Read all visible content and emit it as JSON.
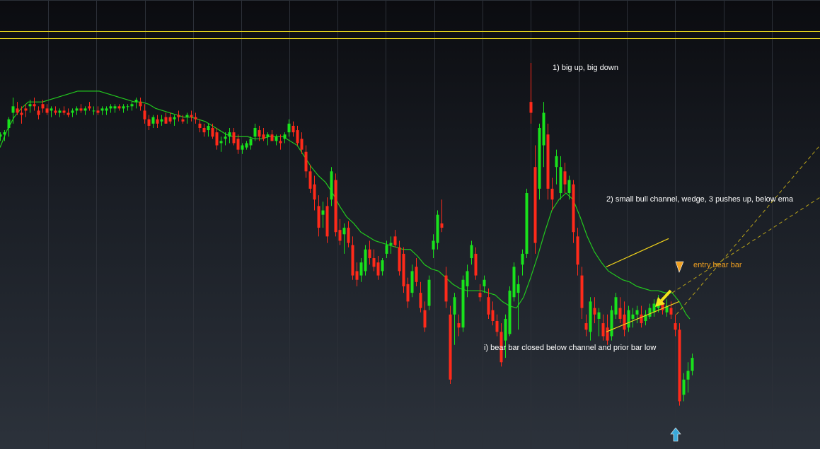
{
  "chart_data": {
    "type": "candlestick",
    "title": "",
    "xlabel": "",
    "ylabel": "",
    "grid": true,
    "colors": {
      "bull": "#19e21c",
      "bear": "#ff2a1a",
      "ema": "#22c81e",
      "price_line": "#e6d41c",
      "channel_line": "#f0d21a",
      "dashed_line": "#b8a21a",
      "arrow": "#f4e21c",
      "signal_arrow": "#f0a020",
      "up_arrow": "#3aa8d8",
      "text": "#ffffff",
      "orange_text": "#f0a020",
      "grid": "#2c3038"
    },
    "price_level": 5.0,
    "ema": [
      [
        0,
        79
      ],
      [
        10,
        87
      ],
      [
        20,
        93
      ],
      [
        30,
        97
      ],
      [
        40,
        100
      ],
      [
        50,
        100
      ],
      [
        60,
        100
      ],
      [
        70,
        101
      ],
      [
        80,
        102
      ],
      [
        90,
        103
      ],
      [
        100,
        104
      ],
      [
        110,
        105
      ],
      [
        120,
        105
      ],
      [
        130,
        105
      ],
      [
        140,
        105
      ],
      [
        150,
        104
      ],
      [
        160,
        103
      ],
      [
        170,
        102
      ],
      [
        180,
        101
      ],
      [
        190,
        100
      ],
      [
        200,
        100
      ],
      [
        210,
        99
      ],
      [
        220,
        97
      ],
      [
        230,
        96
      ],
      [
        240,
        95
      ],
      [
        250,
        94
      ],
      [
        260,
        93
      ],
      [
        270,
        93
      ],
      [
        280,
        92
      ],
      [
        290,
        91
      ],
      [
        300,
        89
      ],
      [
        310,
        87
      ],
      [
        320,
        85
      ],
      [
        330,
        84
      ],
      [
        340,
        84
      ],
      [
        350,
        84
      ],
      [
        360,
        83
      ],
      [
        370,
        83
      ],
      [
        380,
        84
      ],
      [
        390,
        84
      ],
      [
        400,
        84
      ],
      [
        410,
        82
      ],
      [
        420,
        80
      ],
      [
        430,
        75
      ],
      [
        440,
        70
      ],
      [
        450,
        66
      ],
      [
        460,
        63
      ],
      [
        470,
        58
      ],
      [
        480,
        52
      ],
      [
        490,
        47
      ],
      [
        500,
        44
      ],
      [
        510,
        40
      ],
      [
        520,
        38
      ],
      [
        530,
        36
      ],
      [
        540,
        35
      ],
      [
        550,
        34
      ],
      [
        560,
        33
      ],
      [
        570,
        32
      ],
      [
        580,
        32
      ],
      [
        590,
        29
      ],
      [
        600,
        25
      ],
      [
        610,
        23
      ],
      [
        620,
        22
      ],
      [
        630,
        19
      ],
      [
        640,
        16
      ],
      [
        650,
        14
      ],
      [
        660,
        13
      ],
      [
        670,
        13
      ],
      [
        680,
        13
      ],
      [
        690,
        12
      ],
      [
        700,
        11
      ],
      [
        710,
        8
      ],
      [
        720,
        6
      ],
      [
        730,
        5
      ],
      [
        740,
        10
      ],
      [
        750,
        19
      ],
      [
        760,
        29
      ],
      [
        770,
        40
      ],
      [
        780,
        50
      ],
      [
        790,
        55
      ],
      [
        800,
        58
      ],
      [
        810,
        55
      ],
      [
        820,
        47
      ],
      [
        830,
        38
      ],
      [
        840,
        31
      ],
      [
        850,
        26
      ],
      [
        860,
        22
      ],
      [
        870,
        20
      ],
      [
        880,
        18
      ],
      [
        890,
        17
      ],
      [
        900,
        15
      ],
      [
        910,
        14
      ],
      [
        920,
        13
      ],
      [
        930,
        13
      ],
      [
        940,
        12
      ],
      [
        950,
        12
      ],
      [
        960,
        8
      ],
      [
        970,
        2
      ],
      [
        975,
        0
      ]
    ],
    "candles": [
      [
        0,
        84,
        86,
        82,
        85
      ],
      [
        6,
        85,
        87,
        82,
        86
      ],
      [
        12,
        88,
        93,
        84,
        92
      ],
      [
        18,
        95,
        102,
        90,
        98
      ],
      [
        24,
        97,
        100,
        94,
        95
      ],
      [
        30,
        95,
        98,
        90,
        94
      ],
      [
        36,
        97,
        99,
        93,
        96
      ],
      [
        42,
        98,
        101,
        95,
        99
      ],
      [
        48,
        99,
        102,
        96,
        98
      ],
      [
        54,
        96,
        98,
        92,
        94
      ],
      [
        60,
        99,
        101,
        95,
        97
      ],
      [
        66,
        97,
        99,
        94,
        95
      ],
      [
        72,
        96,
        98,
        93,
        97
      ],
      [
        78,
        96,
        98,
        94,
        95
      ],
      [
        84,
        95,
        97,
        93,
        96
      ],
      [
        90,
        96,
        98,
        94,
        95
      ],
      [
        96,
        95,
        97,
        93,
        94
      ],
      [
        102,
        95,
        97,
        93,
        96
      ],
      [
        108,
        96,
        98,
        94,
        97
      ],
      [
        114,
        97,
        99,
        95,
        96
      ],
      [
        120,
        96,
        98,
        94,
        97
      ],
      [
        126,
        98,
        100,
        96,
        97
      ],
      [
        132,
        96,
        98,
        94,
        96
      ],
      [
        138,
        96,
        98,
        94,
        95
      ],
      [
        144,
        96,
        98,
        94,
        97
      ],
      [
        150,
        96,
        98,
        94,
        97
      ],
      [
        156,
        97,
        99,
        95,
        98
      ],
      [
        162,
        97,
        99,
        95,
        98
      ],
      [
        168,
        98,
        99,
        96,
        97
      ],
      [
        174,
        97,
        99,
        95,
        98
      ],
      [
        180,
        98,
        99,
        96,
        98
      ],
      [
        186,
        98,
        100,
        96,
        99
      ],
      [
        192,
        100,
        102,
        97,
        101
      ],
      [
        198,
        100,
        102,
        96,
        98
      ],
      [
        204,
        96,
        99,
        90,
        92
      ],
      [
        210,
        92,
        94,
        87,
        89
      ],
      [
        216,
        90,
        94,
        88,
        93
      ],
      [
        222,
        92,
        94,
        88,
        90
      ],
      [
        228,
        91,
        94,
        89,
        92
      ],
      [
        234,
        93,
        95,
        90,
        90
      ],
      [
        240,
        93,
        95,
        90,
        91
      ],
      [
        246,
        92,
        94,
        89,
        93
      ],
      [
        252,
        94,
        96,
        91,
        93
      ],
      [
        258,
        92,
        94,
        90,
        91
      ],
      [
        264,
        93,
        95,
        90,
        94
      ],
      [
        270,
        94,
        96,
        91,
        93
      ],
      [
        276,
        93,
        95,
        90,
        92
      ],
      [
        282,
        90,
        92,
        86,
        88
      ],
      [
        288,
        88,
        90,
        84,
        86
      ],
      [
        294,
        87,
        90,
        84,
        89
      ],
      [
        300,
        88,
        90,
        83,
        84
      ],
      [
        306,
        86,
        88,
        78,
        80
      ],
      [
        312,
        81,
        84,
        77,
        82
      ],
      [
        318,
        83,
        86,
        80,
        84
      ],
      [
        324,
        84,
        88,
        81,
        86
      ],
      [
        330,
        86,
        88,
        80,
        81
      ],
      [
        336,
        83,
        85,
        76,
        78
      ],
      [
        342,
        78,
        81,
        76,
        80
      ],
      [
        348,
        79,
        82,
        78,
        81
      ],
      [
        354,
        80,
        84,
        78,
        83
      ],
      [
        360,
        84,
        90,
        82,
        88
      ],
      [
        366,
        87,
        89,
        82,
        84
      ],
      [
        372,
        85,
        88,
        82,
        83
      ],
      [
        378,
        84,
        86,
        80,
        85
      ],
      [
        384,
        85,
        87,
        82,
        82
      ],
      [
        390,
        82,
        85,
        80,
        84
      ],
      [
        396,
        82,
        85,
        78,
        81
      ],
      [
        402,
        83,
        86,
        81,
        85
      ],
      [
        408,
        86,
        92,
        84,
        90
      ],
      [
        414,
        89,
        91,
        84,
        86
      ],
      [
        420,
        87,
        89,
        80,
        81
      ],
      [
        426,
        83,
        86,
        76,
        78
      ],
      [
        432,
        77,
        80,
        65,
        68
      ],
      [
        438,
        68,
        71,
        58,
        60
      ],
      [
        444,
        62,
        66,
        50,
        55
      ],
      [
        450,
        52,
        57,
        38,
        42
      ],
      [
        456,
        48,
        54,
        42,
        50
      ],
      [
        462,
        52,
        56,
        35,
        38
      ],
      [
        468,
        55,
        70,
        52,
        68
      ],
      [
        474,
        64,
        67,
        38,
        40
      ],
      [
        480,
        41,
        46,
        34,
        36
      ],
      [
        486,
        39,
        44,
        30,
        42
      ],
      [
        492,
        42,
        45,
        33,
        35
      ],
      [
        498,
        34,
        38,
        18,
        20
      ],
      [
        504,
        22,
        26,
        15,
        18
      ],
      [
        510,
        20,
        28,
        17,
        26
      ],
      [
        516,
        22,
        34,
        20,
        32
      ],
      [
        522,
        32,
        36,
        25,
        28
      ],
      [
        528,
        28,
        32,
        22,
        24
      ],
      [
        534,
        26,
        29,
        18,
        20
      ],
      [
        540,
        22,
        28,
        20,
        27
      ],
      [
        546,
        30,
        36,
        28,
        34
      ],
      [
        552,
        34,
        38,
        30,
        35
      ],
      [
        558,
        38,
        41,
        33,
        34
      ],
      [
        564,
        33,
        36,
        20,
        22
      ],
      [
        570,
        30,
        33,
        12,
        15
      ],
      [
        576,
        16,
        19,
        5,
        8
      ],
      [
        582,
        12,
        25,
        10,
        22
      ],
      [
        588,
        24,
        28,
        15,
        17
      ],
      [
        594,
        12,
        17,
        3,
        5
      ],
      [
        600,
        4,
        8,
        -6,
        -4
      ],
      [
        606,
        6,
        20,
        4,
        18
      ],
      [
        612,
        32,
        39,
        28,
        36
      ],
      [
        618,
        35,
        50,
        32,
        48
      ],
      [
        624,
        44,
        55,
        40,
        42
      ],
      [
        630,
        20,
        24,
        5,
        8
      ],
      [
        636,
        2,
        6,
        -30,
        -28
      ],
      [
        642,
        2,
        12,
        -12,
        10
      ],
      [
        648,
        -2,
        2,
        -8,
        -4
      ],
      [
        654,
        -4,
        20,
        -6,
        18
      ],
      [
        660,
        15,
        25,
        10,
        22
      ],
      [
        666,
        28,
        36,
        25,
        34
      ],
      [
        672,
        30,
        33,
        18,
        20
      ],
      [
        678,
        12,
        16,
        8,
        10
      ],
      [
        684,
        15,
        20,
        12,
        18
      ],
      [
        690,
        10,
        14,
        0,
        2
      ],
      [
        696,
        4,
        8,
        -3,
        -1
      ],
      [
        702,
        -1,
        2,
        -8,
        -6
      ],
      [
        708,
        -6,
        -2,
        -22,
        -20
      ],
      [
        714,
        -10,
        2,
        -18,
        0
      ],
      [
        720,
        -7,
        15,
        -8,
        13
      ],
      [
        726,
        10,
        26,
        8,
        24
      ],
      [
        732,
        12,
        20,
        -5,
        16
      ],
      [
        738,
        25,
        32,
        20,
        30
      ],
      [
        744,
        30,
        60,
        28,
        58
      ],
      [
        750,
        100,
        118,
        90,
        95
      ],
      [
        756,
        70,
        80,
        30,
        35
      ],
      [
        762,
        60,
        90,
        55,
        88
      ],
      [
        768,
        80,
        100,
        70,
        95
      ],
      [
        774,
        85,
        90,
        55,
        60
      ],
      [
        780,
        60,
        65,
        50,
        55
      ],
      [
        786,
        70,
        78,
        62,
        75
      ],
      [
        792,
        58,
        75,
        55,
        70
      ],
      [
        798,
        68,
        72,
        58,
        62
      ],
      [
        804,
        58,
        66,
        55,
        64
      ],
      [
        810,
        62,
        64,
        35,
        40
      ],
      [
        816,
        38,
        42,
        20,
        25
      ],
      [
        822,
        20,
        24,
        0,
        5
      ],
      [
        828,
        -2,
        2,
        -8,
        -5
      ],
      [
        834,
        -6,
        10,
        -10,
        8
      ],
      [
        840,
        5,
        10,
        -2,
        2
      ],
      [
        846,
        0,
        5,
        -8,
        3
      ],
      [
        852,
        -2,
        2,
        -10,
        -8
      ],
      [
        858,
        -4,
        2,
        -12,
        -10
      ],
      [
        864,
        -8,
        6,
        -10,
        4
      ],
      [
        870,
        2,
        12,
        0,
        10
      ],
      [
        876,
        5,
        10,
        -2,
        0
      ],
      [
        882,
        2,
        8,
        -8,
        -5
      ],
      [
        888,
        -4,
        6,
        -6,
        4
      ],
      [
        894,
        0,
        5,
        -4,
        2
      ],
      [
        900,
        2,
        6,
        -2,
        4
      ],
      [
        906,
        2,
        6,
        -4,
        -2
      ],
      [
        912,
        -1,
        4,
        -3,
        2
      ],
      [
        918,
        1,
        7,
        0,
        5
      ],
      [
        924,
        3,
        9,
        1,
        7
      ],
      [
        930,
        5,
        11,
        3,
        9
      ],
      [
        936,
        7,
        10,
        2,
        4
      ],
      [
        942,
        3,
        9,
        1,
        6
      ],
      [
        948,
        5,
        8,
        0,
        2
      ],
      [
        954,
        -2,
        2,
        -8,
        -5
      ],
      [
        960,
        -5,
        -2,
        -40,
        -38
      ],
      [
        966,
        -35,
        -25,
        -38,
        -28
      ],
      [
        972,
        -28,
        -20,
        -34,
        -24
      ],
      [
        978,
        -24,
        -16,
        -26,
        -18
      ]
    ],
    "channel_lines": [
      {
        "from": [
          857,
          -6
        ],
        "to": [
          960,
          8
        ]
      },
      {
        "from": [
          857,
          24
        ],
        "to": [
          945,
          37
        ]
      }
    ],
    "dashed_lines": [
      {
        "from": [
          950,
          12
        ],
        "to": [
          1159,
          56
        ]
      },
      {
        "from": [
          956,
          2
        ],
        "to": [
          1159,
          80
        ]
      }
    ],
    "annotations": [
      {
        "text": "1) big up, big down",
        "x": 781,
        "y": 120
      },
      {
        "text": "2) small bull channel, wedge, 3 pushes up, below ema",
        "x": 857,
        "y": 53
      },
      {
        "text": "entry bear bar",
        "x": 980,
        "y": 22,
        "color": "orange"
      },
      {
        "text": "i) bear bar closed below channel and prior bar low",
        "x": 684,
        "y": -37
      }
    ],
    "ylim": [
      -60,
      147
    ],
    "xlim": [
      0,
      1159
    ]
  }
}
